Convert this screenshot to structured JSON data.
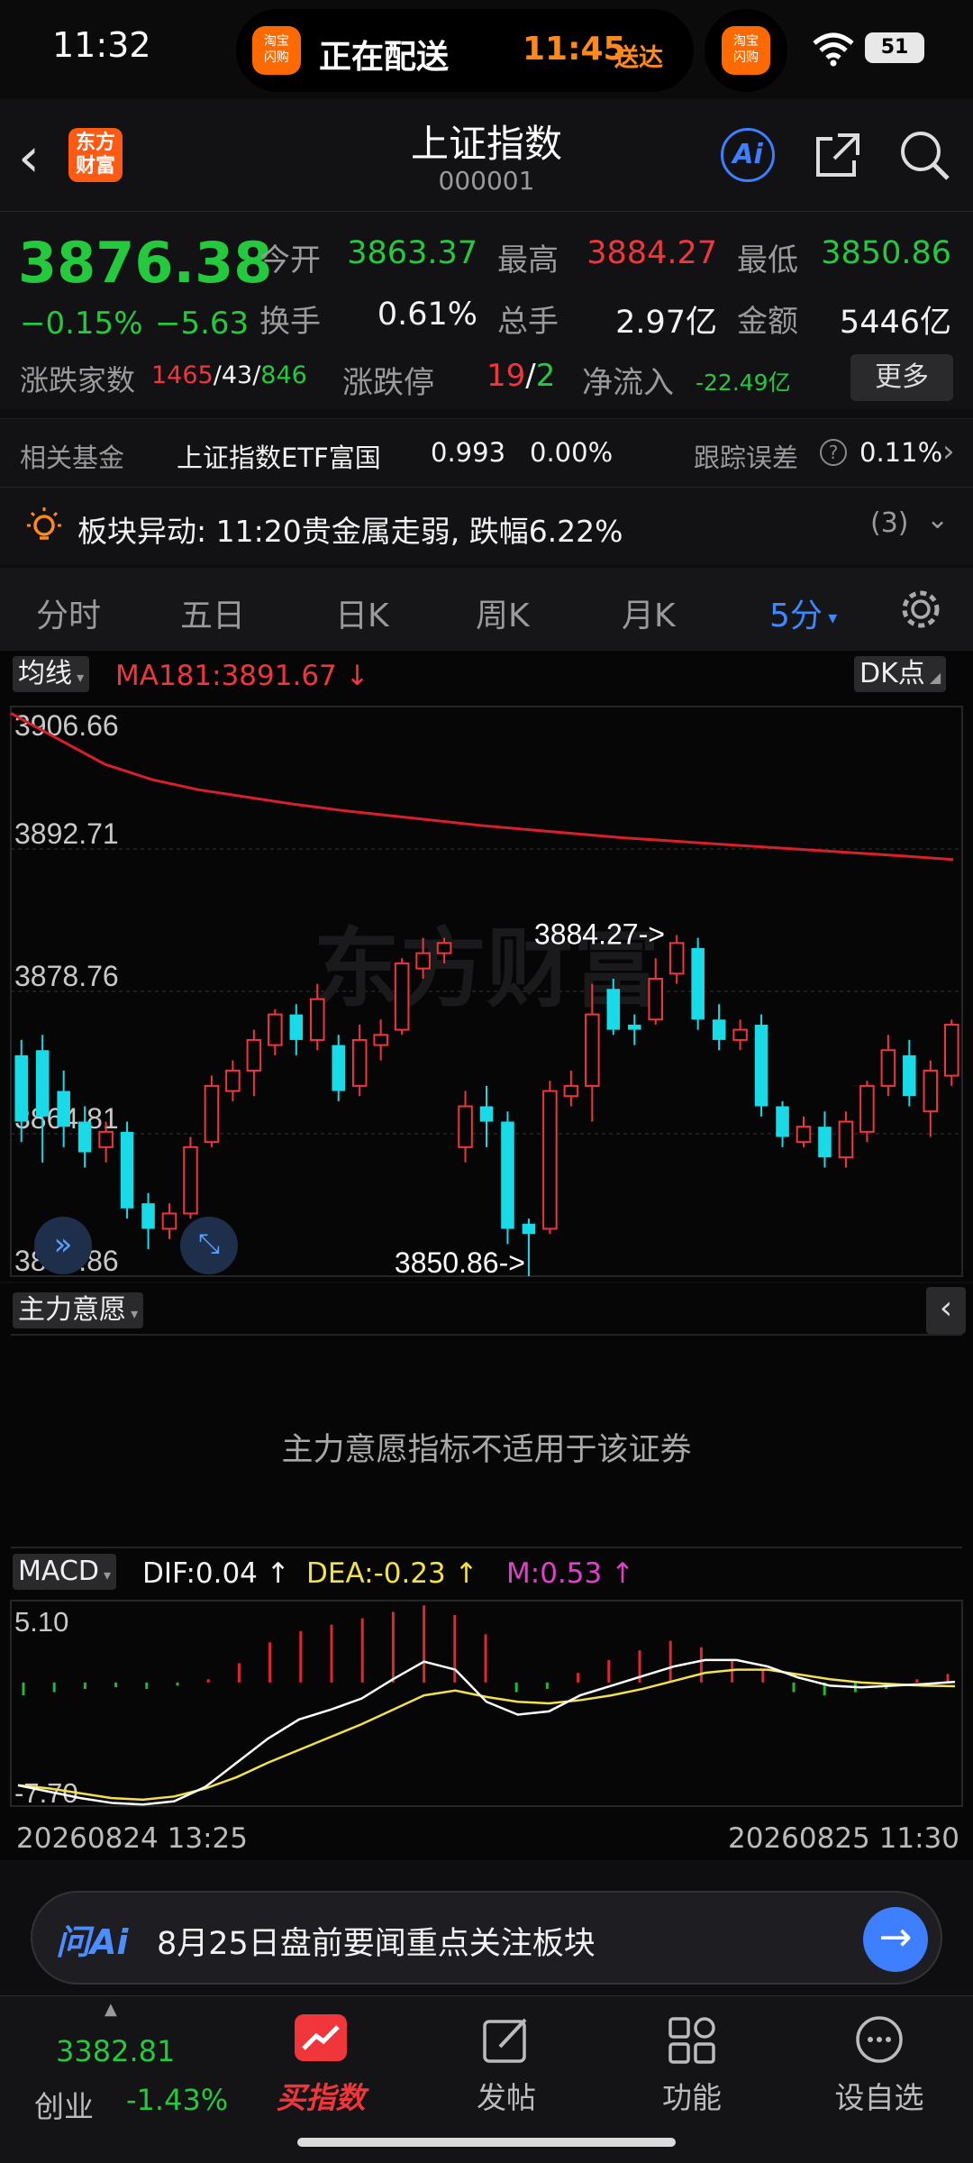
{
  "status_bar": {
    "time": "11:32",
    "app_name_line1": "淘宝",
    "app_name_line2": "闪购",
    "delivery_text": "正在配送",
    "delivery_time": "11:45",
    "delivery_suffix": "送达",
    "battery": "51"
  },
  "header": {
    "logo_line1": "东方",
    "logo_line2": "财富",
    "title": "上证指数",
    "code": "000001",
    "ai_label": "Ai"
  },
  "quote": {
    "price": "3876.38",
    "change_pct": "−0.15%",
    "change_abs": "−5.63",
    "open_label": "今开",
    "open": "3863.37",
    "high_label": "最高",
    "high": "3884.27",
    "low_label": "最低",
    "low": "3850.86",
    "turnover_label": "换手",
    "turnover": "0.61%",
    "volume_label": "总手",
    "volume": "2.97亿",
    "amount_label": "金额",
    "amount": "5446亿",
    "breadth_label": "涨跌家数",
    "breadth_up": "1465",
    "breadth_flat": "43",
    "breadth_down": "846",
    "limit_label": "涨跌停",
    "limit_up": "19",
    "limit_down": "2",
    "netflow_label": "净流入",
    "netflow": "-22.49亿",
    "more_label": "更多"
  },
  "fund": {
    "label": "相关基金",
    "name": "上证指数ETF富国",
    "price": "0.993",
    "change": "0.00%",
    "tracking_label": "跟踪误差",
    "tracking_value": "0.11%"
  },
  "alert": {
    "text": "板块异动: 11:20贵金属走弱, 跌幅6.22%",
    "count": "(3)"
  },
  "tabs": [
    "分时",
    "五日",
    "日K",
    "周K",
    "月K",
    "5分"
  ],
  "kchart": {
    "indicator_label": "均线",
    "ma_text": "MA181:3891.67",
    "dk_label": "DK点",
    "y_labels": [
      "3906.66",
      "3892.71",
      "3878.76",
      "3864.81",
      "3850.86"
    ],
    "high_annotation": "3884.27->",
    "low_annotation": "3850.86->"
  },
  "zhuli": {
    "label": "主力意愿",
    "message": "主力意愿指标不适用于该证券"
  },
  "macd": {
    "label": "MACD",
    "dif": "DIF:0.04",
    "dea": "DEA:-0.23",
    "m": "M:0.53",
    "y_top": "5.10",
    "y_bottom": "-7.70",
    "date_start": "20260824 13:25",
    "date_end": "20260825 11:30"
  },
  "ai_bar": {
    "logo": "问Ai",
    "text": "8月25日盘前要闻重点关注板块"
  },
  "bottom_nav": {
    "ticker_price": "3382.81",
    "ticker_name": "创业",
    "ticker_change": "-1.43%",
    "items": [
      "买指数",
      "发帖",
      "功能",
      "设自选"
    ]
  },
  "chart_data": {
    "type": "candlestick",
    "y_range": [
      3850.86,
      3906.66
    ],
    "candles": [
      {
        "o": 3872.5,
        "c": 3866.0,
        "h": 3874.0,
        "l": 3864.0
      },
      {
        "o": 3873.0,
        "c": 3866.5,
        "h": 3874.5,
        "l": 3862.0
      },
      {
        "o": 3869.0,
        "c": 3865.5,
        "h": 3871.0,
        "l": 3863.5
      },
      {
        "o": 3866.0,
        "c": 3863.0,
        "h": 3867.5,
        "l": 3861.5
      },
      {
        "o": 3863.5,
        "c": 3865.0,
        "h": 3866.0,
        "l": 3862.0
      },
      {
        "o": 3865.0,
        "c": 3857.5,
        "h": 3866.0,
        "l": 3856.5
      },
      {
        "o": 3858.0,
        "c": 3855.5,
        "h": 3859.0,
        "l": 3853.5
      },
      {
        "o": 3855.5,
        "c": 3857.0,
        "h": 3858.0,
        "l": 3854.5
      },
      {
        "o": 3857.0,
        "c": 3863.5,
        "h": 3864.5,
        "l": 3856.5
      },
      {
        "o": 3864.0,
        "c": 3869.5,
        "h": 3870.5,
        "l": 3863.5
      },
      {
        "o": 3869.0,
        "c": 3871.0,
        "h": 3872.0,
        "l": 3868.0
      },
      {
        "o": 3871.0,
        "c": 3874.0,
        "h": 3875.0,
        "l": 3868.5
      },
      {
        "o": 3873.5,
        "c": 3876.5,
        "h": 3877.0,
        "l": 3872.5
      },
      {
        "o": 3876.5,
        "c": 3874.0,
        "h": 3877.5,
        "l": 3872.5
      },
      {
        "o": 3874.0,
        "c": 3878.0,
        "h": 3879.5,
        "l": 3873.0
      },
      {
        "o": 3873.5,
        "c": 3869.0,
        "h": 3874.5,
        "l": 3868.0
      },
      {
        "o": 3869.5,
        "c": 3874.0,
        "h": 3875.5,
        "l": 3868.5
      },
      {
        "o": 3873.5,
        "c": 3874.5,
        "h": 3876.0,
        "l": 3872.0
      },
      {
        "o": 3875.0,
        "c": 3881.5,
        "h": 3882.0,
        "l": 3874.5
      },
      {
        "o": 3881.0,
        "c": 3882.5,
        "h": 3884.0,
        "l": 3880.0
      },
      {
        "o": 3882.5,
        "c": 3883.5,
        "h": 3884.0,
        "l": 3881.5
      },
      {
        "o": 3863.5,
        "c": 3867.5,
        "h": 3869.0,
        "l": 3862.0
      },
      {
        "o": 3867.5,
        "c": 3866.0,
        "h": 3869.5,
        "l": 3863.5
      },
      {
        "o": 3866.0,
        "c": 3855.5,
        "h": 3867.0,
        "l": 3854.0
      },
      {
        "o": 3856.0,
        "c": 3855.0,
        "h": 3856.5,
        "l": 3850.86
      },
      {
        "o": 3855.5,
        "c": 3869.0,
        "h": 3870.0,
        "l": 3855.0
      },
      {
        "o": 3868.5,
        "c": 3869.5,
        "h": 3871.0,
        "l": 3867.5
      },
      {
        "o": 3869.5,
        "c": 3876.5,
        "h": 3879.5,
        "l": 3866.0
      },
      {
        "o": 3879.0,
        "c": 3875.0,
        "h": 3880.0,
        "l": 3874.5
      },
      {
        "o": 3875.5,
        "c": 3875.0,
        "h": 3876.5,
        "l": 3873.5
      },
      {
        "o": 3876.0,
        "c": 3880.0,
        "h": 3882.0,
        "l": 3875.5
      },
      {
        "o": 3880.5,
        "c": 3883.5,
        "h": 3884.27,
        "l": 3879.5
      },
      {
        "o": 3883.0,
        "c": 3876.0,
        "h": 3884.0,
        "l": 3875.0
      },
      {
        "o": 3876.0,
        "c": 3874.0,
        "h": 3877.5,
        "l": 3873.0
      },
      {
        "o": 3874.0,
        "c": 3875.0,
        "h": 3876.0,
        "l": 3873.0
      },
      {
        "o": 3875.5,
        "c": 3867.5,
        "h": 3876.5,
        "l": 3866.5
      },
      {
        "o": 3867.5,
        "c": 3864.5,
        "h": 3868.0,
        "l": 3863.5
      },
      {
        "o": 3864.0,
        "c": 3865.5,
        "h": 3866.5,
        "l": 3863.5
      },
      {
        "o": 3865.5,
        "c": 3862.5,
        "h": 3867.0,
        "l": 3861.5
      },
      {
        "o": 3862.5,
        "c": 3866.0,
        "h": 3867.0,
        "l": 3861.5
      },
      {
        "o": 3865.0,
        "c": 3869.5,
        "h": 3870.0,
        "l": 3864.0
      },
      {
        "o": 3869.5,
        "c": 3873.0,
        "h": 3874.5,
        "l": 3868.5
      },
      {
        "o": 3872.5,
        "c": 3868.5,
        "h": 3874.0,
        "l": 3867.5
      },
      {
        "o": 3867.0,
        "c": 3871.0,
        "h": 3872.0,
        "l": 3864.5
      },
      {
        "o": 3870.5,
        "c": 3875.5,
        "h": 3876.0,
        "l": 3869.5
      }
    ],
    "ma181": [
      3906.0,
      3903.5,
      3901.0,
      3899.5,
      3898.5,
      3897.8,
      3897.1,
      3896.5,
      3896.0,
      3895.5,
      3895.0,
      3894.6,
      3894.2,
      3893.8,
      3893.5,
      3893.2,
      3892.9,
      3892.6,
      3892.3,
      3892.0,
      3891.67
    ],
    "macd": {
      "y_range": [
        -7.7,
        5.1
      ],
      "dif": [
        -6.4,
        -6.8,
        -7.2,
        -7.5,
        -7.6,
        -7.4,
        -6.5,
        -5.0,
        -3.5,
        -2.3,
        -1.7,
        -1.0,
        0.2,
        1.3,
        0.8,
        -1.2,
        -2.0,
        -1.8,
        -0.8,
        -0.2,
        0.4,
        1.0,
        1.4,
        1.4,
        1.0,
        0.3,
        -0.2,
        -0.3,
        -0.2,
        -0.1,
        0.04
      ],
      "dea": [
        -6.4,
        -6.6,
        -6.9,
        -7.2,
        -7.3,
        -7.1,
        -6.6,
        -5.9,
        -5.0,
        -4.2,
        -3.4,
        -2.6,
        -1.7,
        -0.8,
        -0.5,
        -0.9,
        -1.2,
        -1.3,
        -1.1,
        -0.8,
        -0.4,
        0.1,
        0.6,
        0.8,
        0.8,
        0.5,
        0.2,
        0.0,
        -0.1,
        -0.2,
        -0.23
      ],
      "hist": [
        -0.8,
        -0.6,
        -0.4,
        -0.3,
        -0.4,
        -0.2,
        0.2,
        1.2,
        2.5,
        3.2,
        3.6,
        4.0,
        4.4,
        4.8,
        4.2,
        3.0,
        -0.6,
        -0.4,
        0.6,
        1.4,
        2.0,
        2.6,
        2.2,
        1.4,
        0.8,
        -0.6,
        -0.8,
        -0.6,
        -0.4,
        0.2,
        0.53
      ]
    }
  }
}
